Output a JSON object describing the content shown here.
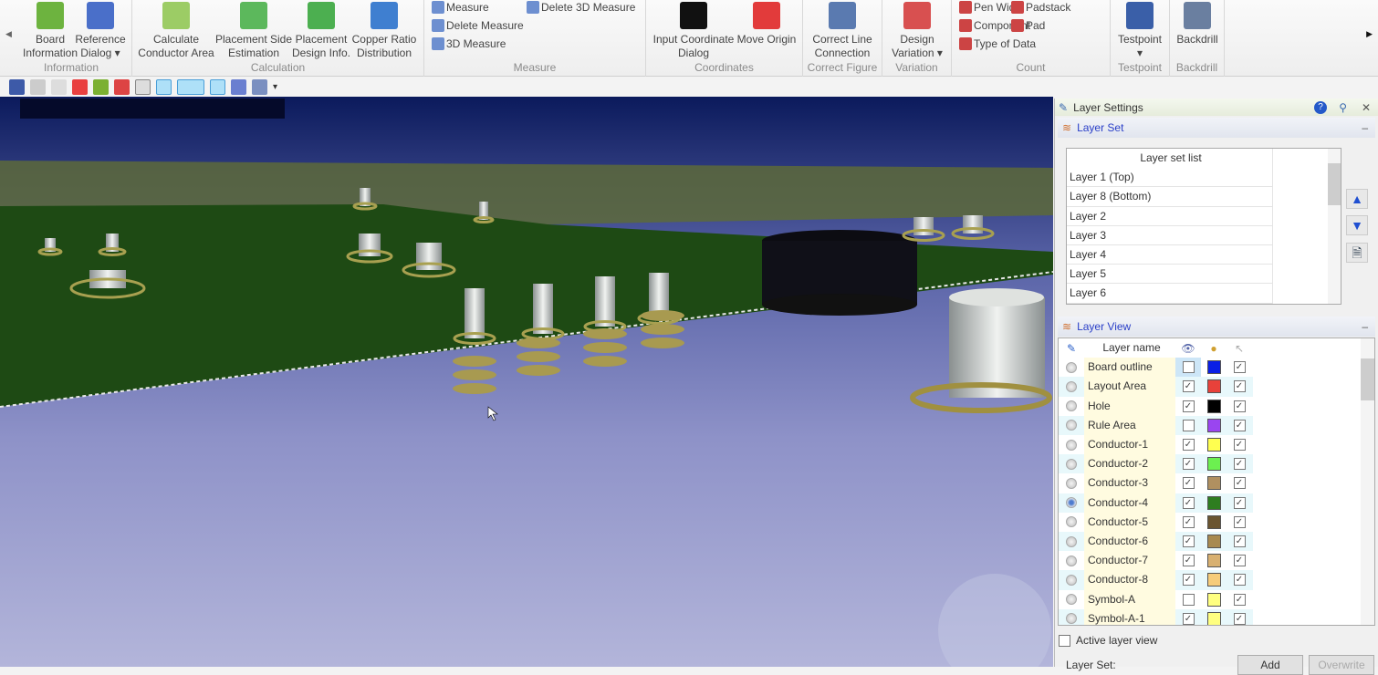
{
  "ribbon": {
    "groups": [
      {
        "label": "Information",
        "buttons": [
          {
            "label1": "Board",
            "label2": "Information",
            "icon": "board-info-icon",
            "color": "#6db33f"
          },
          {
            "label1": "Reference",
            "label2": "Dialog ▾",
            "icon": "microscope-icon",
            "color": "#4a6fc9"
          }
        ]
      },
      {
        "label": "Calculation",
        "buttons": [
          {
            "label1": "Calculate",
            "label2": "Conductor Area",
            "icon": "conductor-area-icon",
            "color": "#9ccc65"
          },
          {
            "label1": "Placement Side",
            "label2": "Estimation",
            "icon": "placement-side-icon",
            "color": "#5cb85c"
          },
          {
            "label1": "Placement",
            "label2": "Design Info.",
            "icon": "placement-design-icon",
            "color": "#4caf50"
          },
          {
            "label1": "Copper Ratio",
            "label2": "Distribution",
            "icon": "copper-ratio-icon",
            "color": "#3f7fd0"
          }
        ]
      },
      {
        "label": "Measure",
        "small": [
          {
            "label": "Measure",
            "icon": "ruler-icon"
          },
          {
            "label": "Delete Measure",
            "icon": "delete-measure-icon"
          },
          {
            "label": "3D Measure",
            "icon": "3d-measure-icon"
          },
          {
            "label": "Delete 3D Measure",
            "icon": "delete-3d-measure-icon"
          }
        ]
      },
      {
        "label": "Coordinates",
        "buttons": [
          {
            "label1": "Input Coordinate",
            "label2": "Dialog",
            "icon": "xy-icon",
            "color": "#111111"
          },
          {
            "label1": "Move Origin",
            "label2": "",
            "icon": "move-origin-icon",
            "color": "#e23b3b"
          }
        ]
      },
      {
        "label": "Correct Figure",
        "buttons": [
          {
            "label1": "Correct Line",
            "label2": "Connection",
            "icon": "line-connection-icon",
            "color": "#5a7ab0"
          }
        ]
      },
      {
        "label": "Variation",
        "buttons": [
          {
            "label1": "Design",
            "label2": "Variation ▾",
            "icon": "design-variation-icon",
            "color": "#d85050"
          }
        ]
      },
      {
        "label": "Count",
        "small": [
          {
            "label": "Pen Width",
            "icon": "pen-width-icon"
          },
          {
            "label": "Component",
            "icon": "component-icon"
          },
          {
            "label": "Type of Data",
            "icon": "type-of-data-icon"
          },
          {
            "label": "Padstack",
            "icon": "padstack-icon"
          },
          {
            "label": "Pad",
            "icon": "pad-icon"
          }
        ]
      },
      {
        "label": "Testpoint",
        "buttons": [
          {
            "label1": "Testpoint",
            "label2": "▾",
            "icon": "testpoint-icon",
            "color": "#3a5fa8"
          }
        ]
      },
      {
        "label": "Backdrill",
        "buttons": [
          {
            "label1": "Backdrill",
            "label2": "",
            "icon": "backdrill-icon",
            "color": "#6a7fa0"
          }
        ]
      }
    ]
  },
  "layer_settings": {
    "title": "Layer Settings",
    "layer_set": {
      "title": "Layer Set",
      "list_header": "Layer set list",
      "items": [
        "Layer 1 (Top)",
        "Layer 8 (Bottom)",
        "Layer 2",
        "Layer 3",
        "Layer 4",
        "Layer 5",
        "Layer 6"
      ]
    },
    "layer_view": {
      "title": "Layer View",
      "header": "Layer name",
      "rows": [
        {
          "name": "Board outline",
          "visible": false,
          "color": "#0a1fe6",
          "selectable": true,
          "active": false
        },
        {
          "name": "Layout Area",
          "visible": true,
          "color": "#e8413a",
          "selectable": true,
          "active": false
        },
        {
          "name": "Hole",
          "visible": true,
          "color": "#000000",
          "selectable": true,
          "active": false
        },
        {
          "name": "Rule Area",
          "visible": false,
          "color": "#9a45f0",
          "selectable": true,
          "active": false
        },
        {
          "name": "Conductor-1",
          "visible": true,
          "color": "#ffff50",
          "selectable": true,
          "active": false
        },
        {
          "name": "Conductor-2",
          "visible": true,
          "color": "#6cf050",
          "selectable": true,
          "active": false
        },
        {
          "name": "Conductor-3",
          "visible": true,
          "color": "#b09060",
          "selectable": true,
          "active": false
        },
        {
          "name": "Conductor-4",
          "visible": true,
          "color": "#2e7d20",
          "selectable": true,
          "active": true
        },
        {
          "name": "Conductor-5",
          "visible": true,
          "color": "#6b5530",
          "selectable": true,
          "active": false
        },
        {
          "name": "Conductor-6",
          "visible": true,
          "color": "#a88a4f",
          "selectable": true,
          "active": false
        },
        {
          "name": "Conductor-7",
          "visible": true,
          "color": "#d8b070",
          "selectable": true,
          "active": false
        },
        {
          "name": "Conductor-8",
          "visible": true,
          "color": "#f6cc7a",
          "selectable": true,
          "active": false
        },
        {
          "name": "Symbol-A",
          "visible": false,
          "color": "#ffff80",
          "selectable": true,
          "active": false
        },
        {
          "name": "Symbol-A-1",
          "visible": true,
          "color": "#ffff80",
          "selectable": true,
          "active": false
        }
      ]
    },
    "active_layer_view": "Active layer view",
    "layer_set_label": "Layer Set:",
    "add": "Add",
    "overwrite": "Overwrite"
  }
}
